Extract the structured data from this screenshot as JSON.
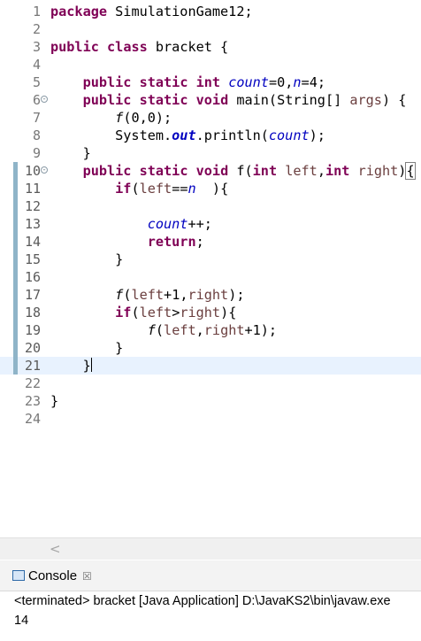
{
  "editor": {
    "lines": [
      {
        "num": "1",
        "code": "<span class=\"kw\">package</span> SimulationGame12;"
      },
      {
        "num": "2",
        "code": ""
      },
      {
        "num": "3",
        "code": "<span class=\"kw\">public</span> <span class=\"kw\">class</span> bracket {"
      },
      {
        "num": "4",
        "code": ""
      },
      {
        "num": "5",
        "code": "    <span class=\"kw\">public</span> <span class=\"kw\">static</span> <span class=\"kw\">int</span> <span class=\"fld\">count</span>=0,<span class=\"fld\">n</span>=4;"
      },
      {
        "num": "6",
        "code": "    <span class=\"kw\">public</span> <span class=\"kw\">static</span> <span class=\"kw\">void</span> main(String[] <span class=\"var\">args</span>) {"
      },
      {
        "num": "7",
        "code": "        <i>f</i>(0,0);"
      },
      {
        "num": "8",
        "code": "        System.<span class=\"sfld\">out</span>.println(<span class=\"fld\">count</span>);"
      },
      {
        "num": "9",
        "code": "    }"
      },
      {
        "num": "10",
        "code": "    <span class=\"kw\">public</span> <span class=\"kw\">static</span> <span class=\"kw\">void</span> f(<span class=\"kw\">int</span> <span class=\"var\">left</span>,<span class=\"kw\">int</span> <span class=\"var\">right</span>)<span class=\"bracebox\">{</span>"
      },
      {
        "num": "11",
        "code": "        <span class=\"kw\">if</span>(<span class=\"var\">left</span>==<span class=\"fld\">n</span>  ){"
      },
      {
        "num": "12",
        "code": ""
      },
      {
        "num": "13",
        "code": "            <span class=\"fld\">count</span>++;"
      },
      {
        "num": "14",
        "code": "            <span class=\"kw\">return</span>;"
      },
      {
        "num": "15",
        "code": "        }"
      },
      {
        "num": "16",
        "code": ""
      },
      {
        "num": "17",
        "code": "        <i>f</i>(<span class=\"var\">left</span>+1,<span class=\"var\">right</span>);"
      },
      {
        "num": "18",
        "code": "        <span class=\"kw\">if</span>(<span class=\"var\">left</span>&gt;<span class=\"var\">right</span>){"
      },
      {
        "num": "19",
        "code": "            <i>f</i>(<span class=\"var\">left</span>,<span class=\"var\">right</span>+1);"
      },
      {
        "num": "20",
        "code": "        }"
      },
      {
        "num": "21",
        "code": "    }<span class=\"caret\"></span>"
      },
      {
        "num": "22",
        "code": ""
      },
      {
        "num": "23",
        "code": "}"
      },
      {
        "num": "24",
        "code": ""
      }
    ]
  },
  "console": {
    "tab_label": "Console",
    "close_glyph": "☒",
    "status": "<terminated> bracket [Java Application] D:\\JavaKS2\\bin\\javaw.exe",
    "output": "14"
  },
  "scroll": {
    "left_arrow": "<"
  },
  "colors": {
    "keyword": "#7f0055",
    "field": "#0000c0",
    "active_line": "#e8f2fe"
  }
}
